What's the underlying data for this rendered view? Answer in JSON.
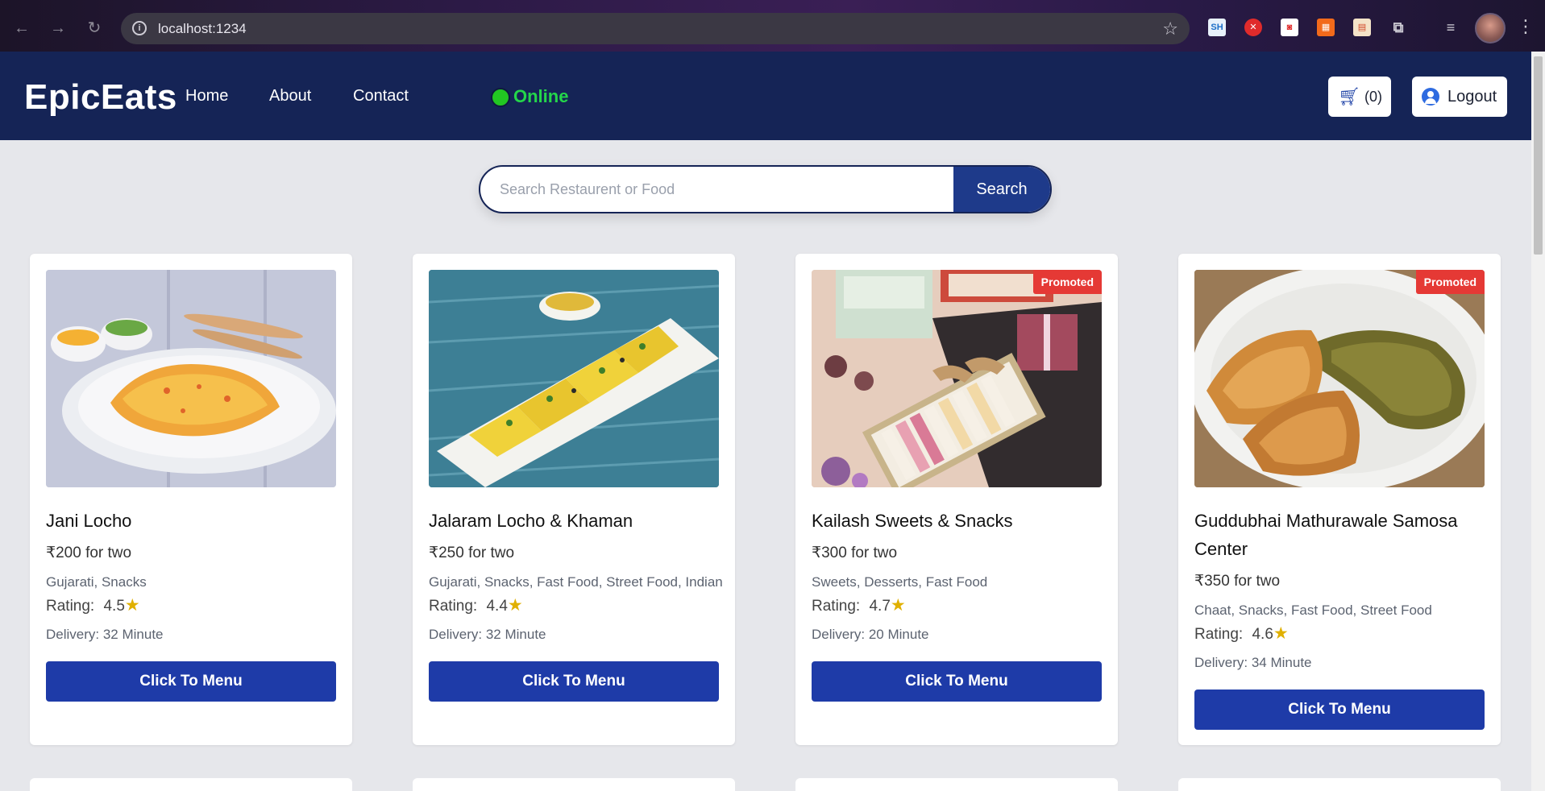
{
  "browser": {
    "url": "localhost:1234",
    "extensions": [
      "SH",
      "",
      "",
      "",
      ""
    ]
  },
  "header": {
    "logo": "EpicEats",
    "nav": [
      "Home",
      "About",
      "Contact"
    ],
    "status": "Online",
    "cart_count": "(0)",
    "logout_label": "Logout"
  },
  "search": {
    "placeholder": "Search Restaurent or Food",
    "button_label": "Search"
  },
  "restaurants": [
    {
      "name": "Jani Locho",
      "price": "₹200 for two",
      "cuisine": "Gujarati, Snacks",
      "rating_label": "Rating:",
      "rating": "4.5",
      "delivery": "Delivery: 32 Minute",
      "promoted": "",
      "button": "Click To Menu"
    },
    {
      "name": "Jalaram Locho & Khaman",
      "price": "₹250 for two",
      "cuisine": "Gujarati, Snacks, Fast Food, Street Food, Indian",
      "rating_label": "Rating:",
      "rating": "4.4",
      "delivery": "Delivery: 32 Minute",
      "promoted": "",
      "button": "Click To Menu"
    },
    {
      "name": "Kailash Sweets & Snacks",
      "price": "₹300 for two",
      "cuisine": "Sweets, Desserts, Fast Food",
      "rating_label": "Rating:",
      "rating": "4.7",
      "delivery": "Delivery: 20 Minute",
      "promoted": "Promoted",
      "button": "Click To Menu"
    },
    {
      "name": "Guddubhai Mathurawale Samosa Center",
      "price": "₹350 for two",
      "cuisine": "Chaat, Snacks, Fast Food, Street Food",
      "rating_label": "Rating:",
      "rating": "4.6",
      "delivery": "Delivery: 34 Minute",
      "promoted": "Promoted",
      "button": "Click To Menu"
    }
  ],
  "colors": {
    "header_bg": "#152456",
    "button_bg": "#1e3ba8",
    "online": "#24d64a",
    "promoted": "#e53935",
    "star": "#e0b000"
  }
}
